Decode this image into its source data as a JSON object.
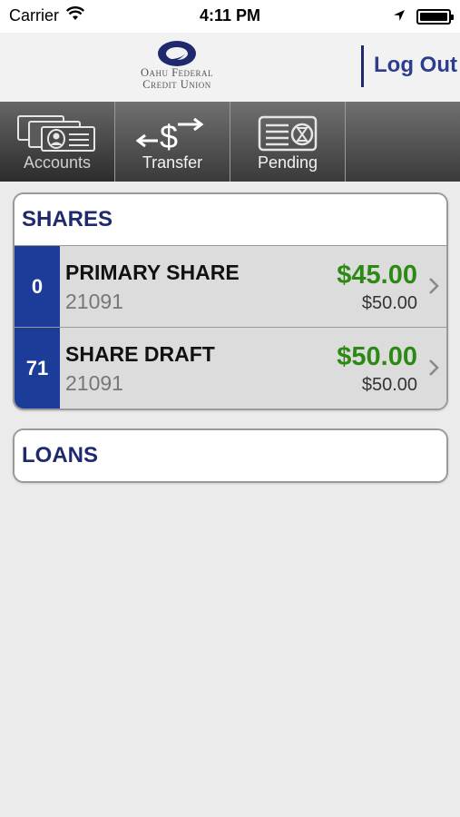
{
  "status_bar": {
    "carrier": "Carrier",
    "time": "4:11 PM"
  },
  "header": {
    "logo_line1": "Oahu Federal",
    "logo_line2": "Credit Union",
    "logout_label": "Log Out"
  },
  "tabs": [
    {
      "label": "Accounts",
      "icon": "accounts-icon",
      "active": true
    },
    {
      "label": "Transfer",
      "icon": "transfer-icon",
      "active": false
    },
    {
      "label": "Pending",
      "icon": "pending-icon",
      "active": false
    }
  ],
  "shares": {
    "title": "SHARES",
    "accounts": [
      {
        "badge": "0",
        "name": "PRIMARY SHARE",
        "number": "21091",
        "balance": "$45.00",
        "available": "$50.00"
      },
      {
        "badge": "71",
        "name": "SHARE DRAFT",
        "number": "21091",
        "balance": "$50.00",
        "available": "$50.00"
      }
    ]
  },
  "loans": {
    "title": "LOANS"
  },
  "colors": {
    "brand_navy": "#1f2a6e",
    "badge_blue": "#1b3c99",
    "balance_green": "#2c8a14"
  }
}
